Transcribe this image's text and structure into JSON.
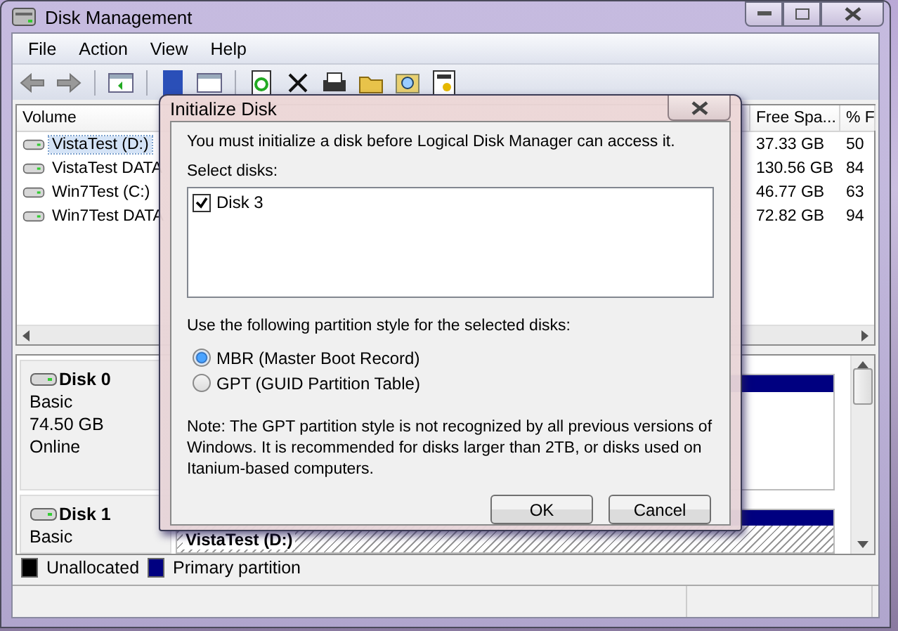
{
  "window": {
    "title": "Disk Management"
  },
  "menu": [
    "File",
    "Action",
    "View",
    "Help"
  ],
  "volume_table": {
    "columns": [
      "Volume",
      "Free Spa...",
      "% F"
    ],
    "rows": [
      {
        "cells": [
          "VistaTest (D:)",
          "37.33 GB",
          "50"
        ],
        "selected": true
      },
      {
        "cells": [
          "VistaTest DATA",
          "130.56 GB",
          "84"
        ],
        "selected": false
      },
      {
        "cells": [
          "Win7Test (C:)",
          "46.77 GB",
          "63"
        ],
        "selected": false
      },
      {
        "cells": [
          "Win7Test DATA",
          "72.82 GB",
          "94"
        ],
        "selected": false
      }
    ]
  },
  "disks": [
    {
      "name": "Disk 0",
      "details": [
        "Basic",
        "74.50 GB",
        "Online"
      ],
      "partitions": [
        {
          "selected": false
        }
      ]
    },
    {
      "name": "Disk 1",
      "details": [
        "Basic"
      ],
      "partitions": [
        {
          "label": "VistaTest  (D:)",
          "selected": true
        }
      ]
    }
  ],
  "legend": [
    {
      "label": "Unallocated",
      "color": "#000000"
    },
    {
      "label": "Primary partition",
      "color": "#000080"
    }
  ],
  "dialog": {
    "title": "Initialize Disk",
    "message": "You must initialize a disk before Logical Disk Manager can access it.",
    "select_label": "Select disks:",
    "disks": [
      {
        "label": "Disk 3",
        "checked": true
      }
    ],
    "style_label": "Use the following partition style for the selected disks:",
    "styles": [
      {
        "label": "MBR (Master Boot Record)",
        "selected": true
      },
      {
        "label": "GPT (GUID Partition Table)",
        "selected": false
      }
    ],
    "note": "Note: The GPT partition style is not recognized by all previous versions of Windows. It is recommended for disks larger than 2TB, or disks used on Itanium-based computers.",
    "buttons": [
      "OK",
      "Cancel"
    ]
  }
}
